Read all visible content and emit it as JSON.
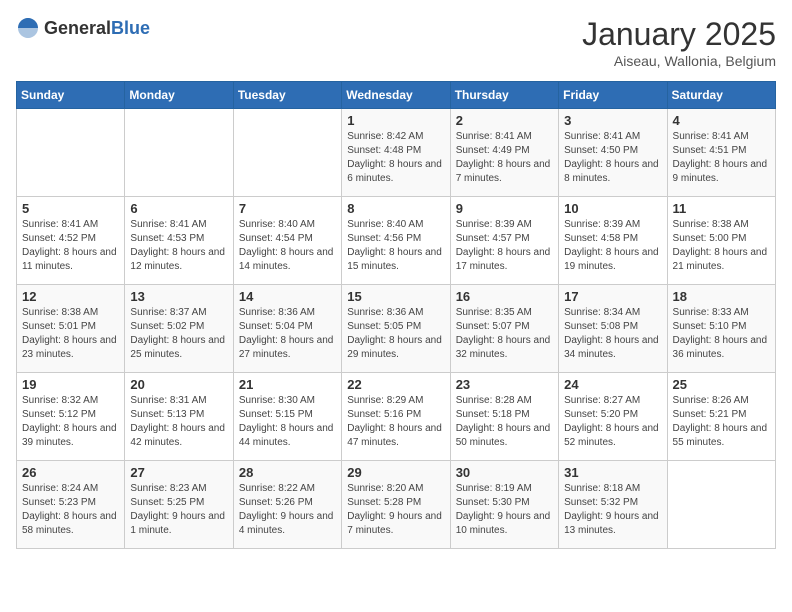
{
  "logo": {
    "general": "General",
    "blue": "Blue"
  },
  "header": {
    "title": "January 2025",
    "location": "Aiseau, Wallonia, Belgium"
  },
  "weekdays": [
    "Sunday",
    "Monday",
    "Tuesday",
    "Wednesday",
    "Thursday",
    "Friday",
    "Saturday"
  ],
  "weeks": [
    [
      {
        "day": "",
        "info": ""
      },
      {
        "day": "",
        "info": ""
      },
      {
        "day": "",
        "info": ""
      },
      {
        "day": "1",
        "info": "Sunrise: 8:42 AM\nSunset: 4:48 PM\nDaylight: 8 hours and 6 minutes."
      },
      {
        "day": "2",
        "info": "Sunrise: 8:41 AM\nSunset: 4:49 PM\nDaylight: 8 hours and 7 minutes."
      },
      {
        "day": "3",
        "info": "Sunrise: 8:41 AM\nSunset: 4:50 PM\nDaylight: 8 hours and 8 minutes."
      },
      {
        "day": "4",
        "info": "Sunrise: 8:41 AM\nSunset: 4:51 PM\nDaylight: 8 hours and 9 minutes."
      }
    ],
    [
      {
        "day": "5",
        "info": "Sunrise: 8:41 AM\nSunset: 4:52 PM\nDaylight: 8 hours and 11 minutes."
      },
      {
        "day": "6",
        "info": "Sunrise: 8:41 AM\nSunset: 4:53 PM\nDaylight: 8 hours and 12 minutes."
      },
      {
        "day": "7",
        "info": "Sunrise: 8:40 AM\nSunset: 4:54 PM\nDaylight: 8 hours and 14 minutes."
      },
      {
        "day": "8",
        "info": "Sunrise: 8:40 AM\nSunset: 4:56 PM\nDaylight: 8 hours and 15 minutes."
      },
      {
        "day": "9",
        "info": "Sunrise: 8:39 AM\nSunset: 4:57 PM\nDaylight: 8 hours and 17 minutes."
      },
      {
        "day": "10",
        "info": "Sunrise: 8:39 AM\nSunset: 4:58 PM\nDaylight: 8 hours and 19 minutes."
      },
      {
        "day": "11",
        "info": "Sunrise: 8:38 AM\nSunset: 5:00 PM\nDaylight: 8 hours and 21 minutes."
      }
    ],
    [
      {
        "day": "12",
        "info": "Sunrise: 8:38 AM\nSunset: 5:01 PM\nDaylight: 8 hours and 23 minutes."
      },
      {
        "day": "13",
        "info": "Sunrise: 8:37 AM\nSunset: 5:02 PM\nDaylight: 8 hours and 25 minutes."
      },
      {
        "day": "14",
        "info": "Sunrise: 8:36 AM\nSunset: 5:04 PM\nDaylight: 8 hours and 27 minutes."
      },
      {
        "day": "15",
        "info": "Sunrise: 8:36 AM\nSunset: 5:05 PM\nDaylight: 8 hours and 29 minutes."
      },
      {
        "day": "16",
        "info": "Sunrise: 8:35 AM\nSunset: 5:07 PM\nDaylight: 8 hours and 32 minutes."
      },
      {
        "day": "17",
        "info": "Sunrise: 8:34 AM\nSunset: 5:08 PM\nDaylight: 8 hours and 34 minutes."
      },
      {
        "day": "18",
        "info": "Sunrise: 8:33 AM\nSunset: 5:10 PM\nDaylight: 8 hours and 36 minutes."
      }
    ],
    [
      {
        "day": "19",
        "info": "Sunrise: 8:32 AM\nSunset: 5:12 PM\nDaylight: 8 hours and 39 minutes."
      },
      {
        "day": "20",
        "info": "Sunrise: 8:31 AM\nSunset: 5:13 PM\nDaylight: 8 hours and 42 minutes."
      },
      {
        "day": "21",
        "info": "Sunrise: 8:30 AM\nSunset: 5:15 PM\nDaylight: 8 hours and 44 minutes."
      },
      {
        "day": "22",
        "info": "Sunrise: 8:29 AM\nSunset: 5:16 PM\nDaylight: 8 hours and 47 minutes."
      },
      {
        "day": "23",
        "info": "Sunrise: 8:28 AM\nSunset: 5:18 PM\nDaylight: 8 hours and 50 minutes."
      },
      {
        "day": "24",
        "info": "Sunrise: 8:27 AM\nSunset: 5:20 PM\nDaylight: 8 hours and 52 minutes."
      },
      {
        "day": "25",
        "info": "Sunrise: 8:26 AM\nSunset: 5:21 PM\nDaylight: 8 hours and 55 minutes."
      }
    ],
    [
      {
        "day": "26",
        "info": "Sunrise: 8:24 AM\nSunset: 5:23 PM\nDaylight: 8 hours and 58 minutes."
      },
      {
        "day": "27",
        "info": "Sunrise: 8:23 AM\nSunset: 5:25 PM\nDaylight: 9 hours and 1 minute."
      },
      {
        "day": "28",
        "info": "Sunrise: 8:22 AM\nSunset: 5:26 PM\nDaylight: 9 hours and 4 minutes."
      },
      {
        "day": "29",
        "info": "Sunrise: 8:20 AM\nSunset: 5:28 PM\nDaylight: 9 hours and 7 minutes."
      },
      {
        "day": "30",
        "info": "Sunrise: 8:19 AM\nSunset: 5:30 PM\nDaylight: 9 hours and 10 minutes."
      },
      {
        "day": "31",
        "info": "Sunrise: 8:18 AM\nSunset: 5:32 PM\nDaylight: 9 hours and 13 minutes."
      },
      {
        "day": "",
        "info": ""
      }
    ]
  ]
}
